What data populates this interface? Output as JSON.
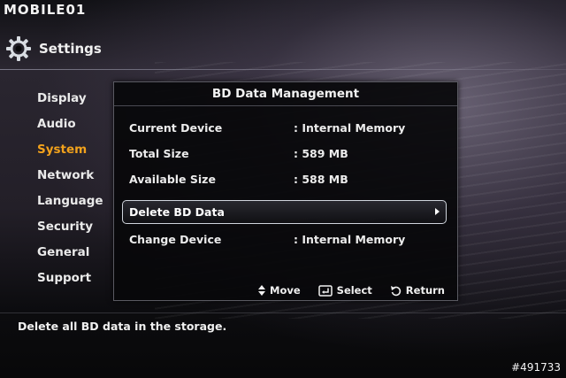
{
  "watermark": "MOBILE01",
  "photo_id": "#491733",
  "header": {
    "title": "Settings",
    "icon": "gear-icon"
  },
  "menu": {
    "items": [
      {
        "label": "Display",
        "active": false
      },
      {
        "label": "Audio",
        "active": false
      },
      {
        "label": "System",
        "active": true
      },
      {
        "label": "Network",
        "active": false
      },
      {
        "label": "Language",
        "active": false
      },
      {
        "label": "Security",
        "active": false
      },
      {
        "label": "General",
        "active": false
      },
      {
        "label": "Support",
        "active": false
      }
    ]
  },
  "dialog": {
    "title": "BD Data Management",
    "current_device": {
      "label": "Current Device",
      "value": ": Internal Memory"
    },
    "total_size": {
      "label": "Total Size",
      "value": ": 589 MB"
    },
    "available_size": {
      "label": "Available Size",
      "value": ": 588 MB"
    },
    "delete_bd_data": {
      "label": "Delete BD Data"
    },
    "change_device": {
      "label": "Change Device",
      "value": ": Internal Memory"
    },
    "keys": {
      "move": "Move",
      "select": "Select",
      "return": "Return"
    }
  },
  "hint": "Delete all BD data in the storage.",
  "colors": {
    "active_menu": "#f2a21c",
    "background": "#0a0a0c"
  }
}
